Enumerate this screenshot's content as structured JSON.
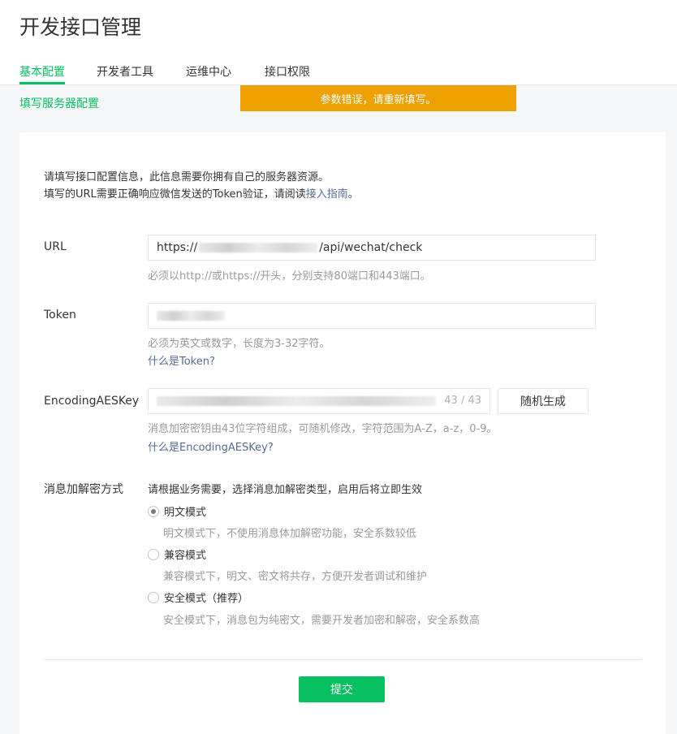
{
  "page": {
    "title": "开发接口管理"
  },
  "tabs": [
    {
      "label": "基本配置",
      "active": true
    },
    {
      "label": "开发者工具"
    },
    {
      "label": "运维中心"
    },
    {
      "label": "接口权限"
    }
  ],
  "sub_link": "填写服务器配置",
  "toast": "参数错误，请重新填写。",
  "intro": {
    "line1": "请填写接口配置信息，此信息需要你拥有自己的服务器资源。",
    "line2_prefix": "填写的URL需要正确响应微信发送的Token验证，请阅读",
    "line2_link": "接入指南",
    "line2_suffix": "。"
  },
  "url_field": {
    "label": "URL",
    "value_prefix": "https://",
    "value_suffix": "/api/wechat/check",
    "hint": "必须以http://或https://开头，分别支持80端口和443端口。"
  },
  "token_field": {
    "label": "Token",
    "hint": "必须为英文或数字，长度为3-32字符。",
    "help_link": "什么是Token?"
  },
  "aes_field": {
    "label": "EncodingAESKey",
    "counter": "43 / 43",
    "generate_button": "随机生成",
    "hint": "消息加密密钥由43位字符组成，可随机修改，字符范围为A-Z，a-z，0-9。",
    "help_link": "什么是EncodingAESKey?"
  },
  "encryption": {
    "label": "消息加解密方式",
    "intro": "请根据业务需要，选择消息加解密类型，启用后将立即生效",
    "options": [
      {
        "label": "明文模式",
        "desc": "明文模式下，不使用消息体加解密功能，安全系数较低",
        "checked": true
      },
      {
        "label": "兼容模式",
        "desc": "兼容模式下，明文、密文将共存，方便开发者调试和维护",
        "checked": false
      },
      {
        "label": "安全模式（推荐）",
        "desc": "安全模式下，消息包为纯密文，需要开发者加密和解密，安全系数高",
        "checked": false
      }
    ]
  },
  "submit_button": "提交",
  "colors": {
    "accent": "#07c160",
    "warning": "#eea100",
    "link": "#576b95"
  }
}
